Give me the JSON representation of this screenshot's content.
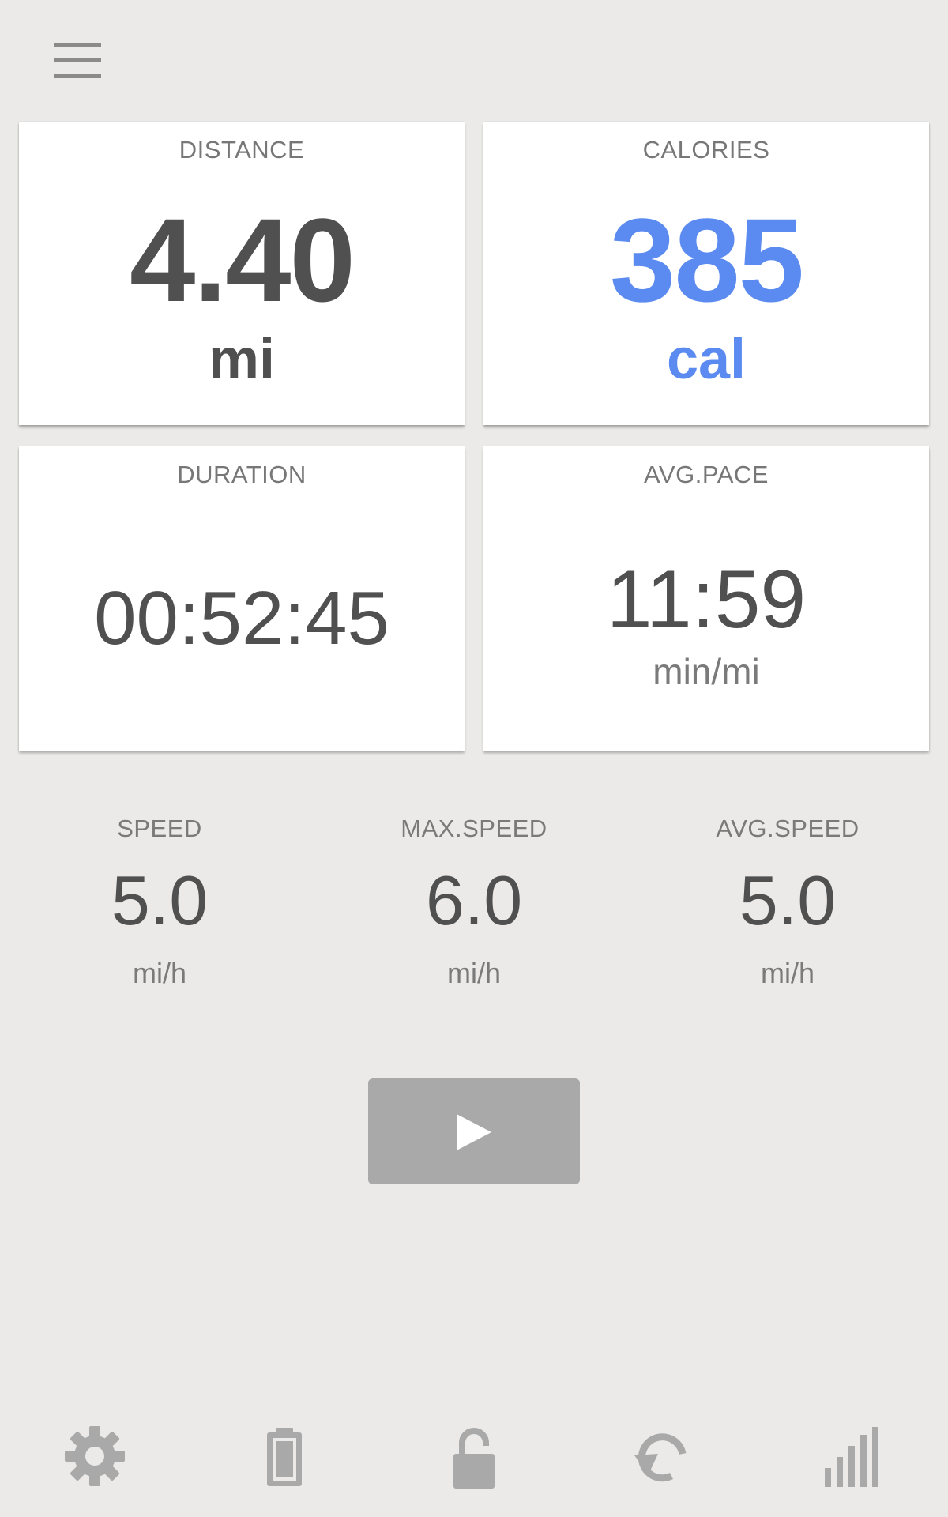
{
  "header": {
    "menu_icon": "hamburger-menu-icon"
  },
  "cards": {
    "distance": {
      "label": "DISTANCE",
      "value": "4.40",
      "unit": "mi",
      "color": "#505050"
    },
    "calories": {
      "label": "CALORIES",
      "value": "385",
      "unit": "cal",
      "color": "#5b8bf0"
    },
    "duration": {
      "label": "DURATION",
      "value": "00:52:45"
    },
    "avg_pace": {
      "label": "AVG.PACE",
      "value": "11:59",
      "unit": "min/mi"
    }
  },
  "stats": {
    "speed": {
      "label": "SPEED",
      "value": "5.0",
      "unit": "mi/h"
    },
    "max_speed": {
      "label": "MAX.SPEED",
      "value": "6.0",
      "unit": "mi/h"
    },
    "avg_speed": {
      "label": "AVG.SPEED",
      "value": "5.0",
      "unit": "mi/h"
    }
  },
  "controls": {
    "play_icon": "play-icon"
  },
  "toolbar": {
    "icons": [
      "gear-icon",
      "battery-icon",
      "lock-icon",
      "sync-icon",
      "bar-chart-icon"
    ]
  },
  "colors": {
    "background": "#ebeae8",
    "accent": "#5b8bf0",
    "icon_gray": "#a9a9a9"
  }
}
